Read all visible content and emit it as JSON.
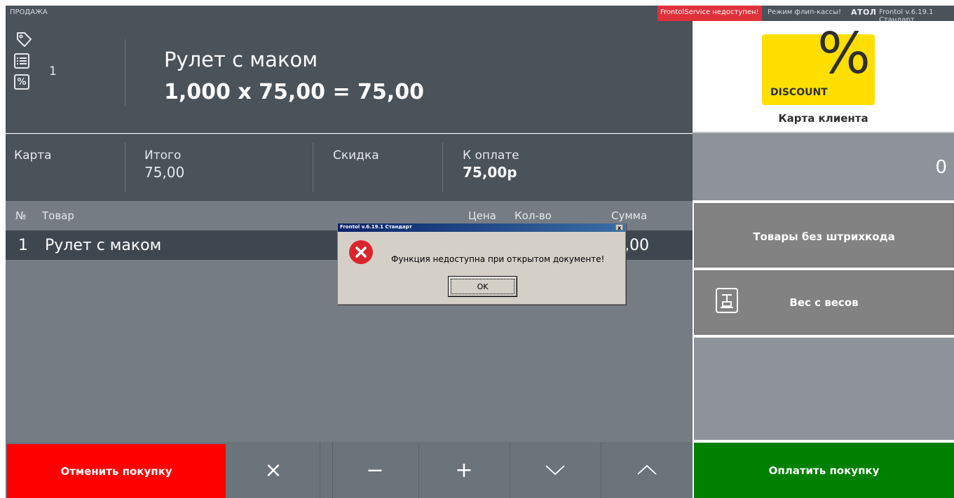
{
  "topbar": {
    "title": "ПРОДАЖА",
    "service_status": "FrontolService недоступен!",
    "flip_mode": "Режим флип-кассы!",
    "brand": "АТОЛ",
    "version": "Frontol v.6.19.1 Стандарт"
  },
  "header": {
    "position_count": "1",
    "product_name": "Рулет с маком",
    "calculation": "1,000 x 75,00 = 75,00"
  },
  "totals": {
    "card_label": "Карта",
    "total_label": "Итого",
    "total_value": "75,00",
    "discount_label": "Скидка",
    "to_pay_label": "К оплате",
    "to_pay_value": "75,00р"
  },
  "list": {
    "columns": {
      "num": "№",
      "product": "Товар",
      "price": "Цена",
      "qty": "Кол-во",
      "sum": "Сумма"
    },
    "rows": [
      {
        "num": "1",
        "name": "Рулет с маком",
        "sum_partial": ",00"
      }
    ]
  },
  "bottom": {
    "cancel_label": "Отменить покупку",
    "delete_symbol": "×",
    "minus_symbol": "−",
    "plus_symbol": "+"
  },
  "right": {
    "discount_badge": "DISCOUNT",
    "percent_symbol": "%",
    "client_card_label": "Карта клиента",
    "counter_value": "0",
    "no_barcode_label": "Товары без штрихкода",
    "scale_label": "Вес с весов",
    "pay_label": "Оплатить покупку"
  },
  "dialog": {
    "title": "Frontol v.6.19.1 Стандарт",
    "close_symbol": "x",
    "message": "Функция недоступна при открытом документе!",
    "ok_label": "OK"
  },
  "colors": {
    "dark_panel": "#4a525a",
    "list_bg": "#757c84",
    "selected_row": "#3e4750",
    "cancel_red": "#ff0000",
    "pay_green": "#008000",
    "discount_yellow": "#ffdf00",
    "service_alert": "#e0313b"
  }
}
